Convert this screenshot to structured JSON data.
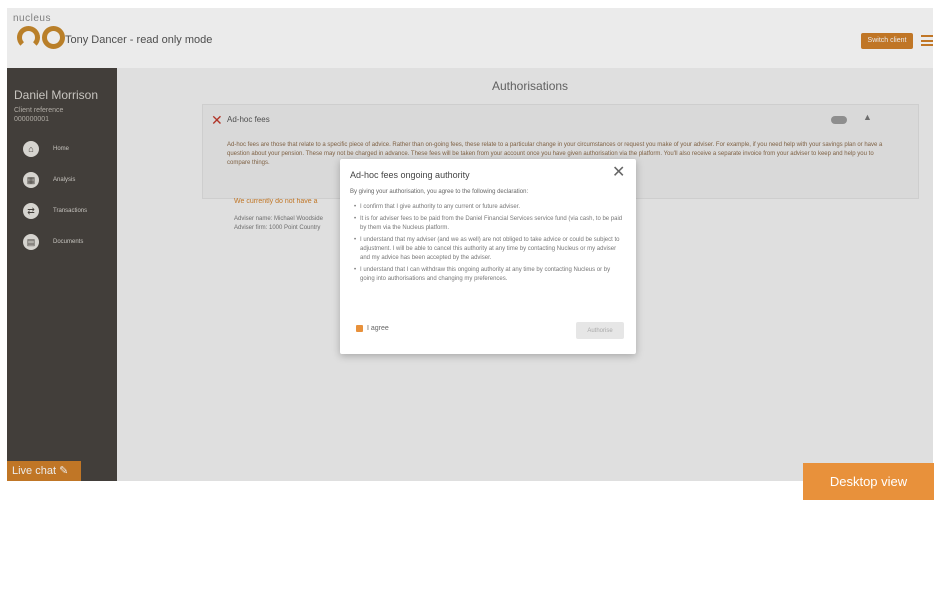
{
  "header": {
    "logo_small": "nucleus",
    "logo_big": "go",
    "title": "Tony Dancer - read only mode",
    "switch_label": "Switch client",
    "menu_icon": "hamburger-icon"
  },
  "sidebar": {
    "user_name": "Daniel Morrison",
    "client_ref_label": "Client reference",
    "client_ref_value": "000000001",
    "items": [
      {
        "label": "Home",
        "icon": "home-icon",
        "glyph": "⌂"
      },
      {
        "label": "Analysis",
        "icon": "analysis-icon",
        "glyph": "▦"
      },
      {
        "label": "Transactions",
        "icon": "transfer-icon",
        "glyph": "⇄"
      },
      {
        "label": "Documents",
        "icon": "document-icon",
        "glyph": "▤"
      }
    ],
    "live_chat": "Live chat"
  },
  "main": {
    "page_title": "Authorisations",
    "card": {
      "title": "Ad-hoc fees",
      "text": "Ad-hoc fees are those that relate to a specific piece of advice. Rather than on-going fees, these relate to a particular change in your circumstances or request you make of your adviser. For example, if you need help with your savings plan or have a question about your pension. These may not be charged in advance. These fees will be taken from your account once you have given authorisation via the platform. You'll also receive a separate invoice from your adviser to keep and help you to compare things.",
      "warning": "We currently do not have a",
      "lines": [
        "Adviser name: Michael Woodside",
        "Adviser firm: 1000 Point Country"
      ]
    },
    "desktop_view": "Desktop view"
  },
  "modal": {
    "title": "Ad-hoc fees ongoing authority",
    "intro": "By giving your authorisation, you agree to the following declaration:",
    "points": [
      "I confirm that I give authority to any current or future adviser.",
      "It is for adviser fees to be paid from the Daniel Financial Services service fund (via cash, to be paid by them via the Nucleus platform.",
      "I understand that my adviser (and we as well) are not obliged to take advice or could be subject to adjustment. I will be able to cancel this authority at any time by contacting Nucleus or my adviser and my advice has been accepted by the adviser.",
      "I understand that I can withdraw this ongoing authority at any time by contacting Nucleus or by going into authorisations and changing my preferences."
    ],
    "agree_label": "I agree",
    "authorise_label": "Authorise"
  },
  "colors": {
    "accent": "#d1802a",
    "sidebar": "#48443f",
    "close_red": "#c0392b"
  }
}
